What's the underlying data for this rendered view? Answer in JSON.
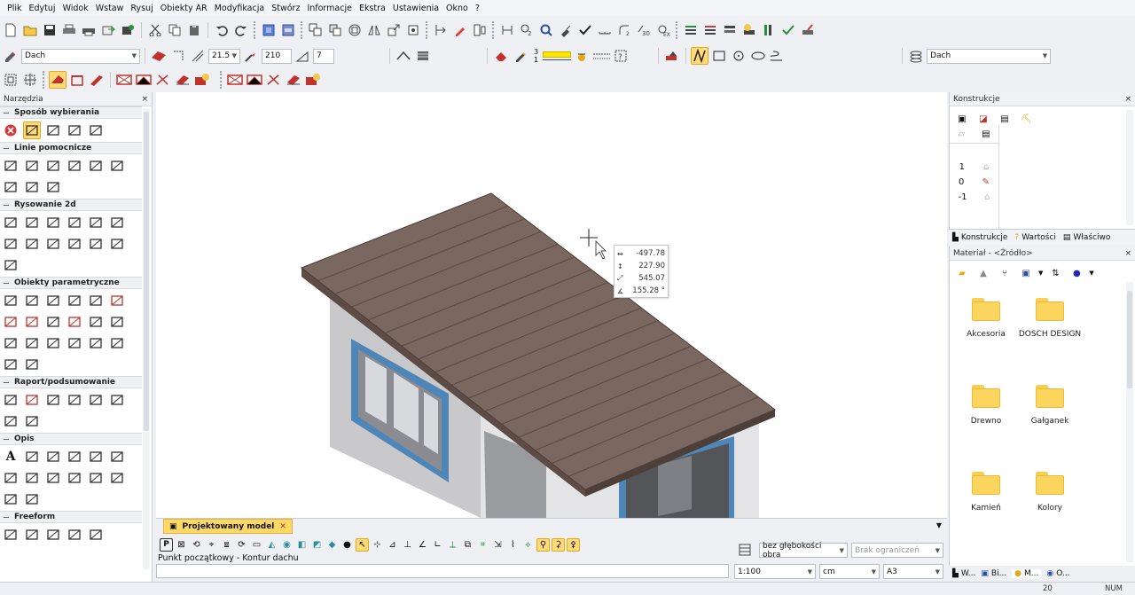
{
  "menu": [
    "Plik",
    "Edytuj",
    "Widok",
    "Wstaw",
    "Rysuj",
    "Obiekty AR",
    "Modyfikacja",
    "Stwórz",
    "Informacje",
    "Ekstra",
    "Ustawienia",
    "Okno",
    "?"
  ],
  "toolbar": {
    "layer_combo": "Dach",
    "thickness_combo": "21.5",
    "angle_value": "210",
    "count_value": "7",
    "pen_top": "3",
    "pen_bottom": "1",
    "layer_combo_right": "Dach",
    "accent_color": "#ffe600"
  },
  "left_panel": {
    "title": "Narzędzia",
    "sections": [
      {
        "title": "Sposób wybierania",
        "icons": [
          "delete-selection-icon",
          "select-arrow-icon",
          "layers-select-icon",
          "rectangle-select-icon",
          "polyline-select-icon"
        ]
      },
      {
        "title": "Linie pomocnicze",
        "icons": [
          "diagonal-line-icon",
          "angle-line-icon",
          "parallel-line-icon",
          "hatched-line-icon",
          "crosshair-icon",
          "dial-icon",
          "circle-point-icon",
          "half-circle-icon",
          "rotate-point-icon"
        ]
      },
      {
        "title": "Rysowanie 2d",
        "icons": [
          "line-icon",
          "polyline-icon",
          "rectangle-icon",
          "dotted-rectangle-icon",
          "spiral-icon",
          "ring-icon",
          "circle-dot-icon",
          "arc-segment-icon",
          "arc-rotate-icon",
          "arc-icon",
          "triangle-icon",
          "ellipse-icon",
          "spline-icon"
        ]
      },
      {
        "title": "Obiekty parametryczne",
        "icons": [
          "wall-icon",
          "slab-icon",
          "beam-icon",
          "column-icon",
          "stair-icon",
          "roof-icon",
          "window-icon",
          "door-icon",
          "opening-icon",
          "roof-red-icon",
          "pipe-icon",
          "panel-icon",
          "grid-icon",
          "frame-icon",
          "box-icon",
          "truss-icon",
          "area-icon",
          "label-m2-icon",
          "dimension-icon",
          "plan-icon"
        ]
      },
      {
        "title": "Raport/podsumowanie",
        "icons": [
          "report-icon",
          "report-red-icon",
          "book-icon",
          "building-plan-icon",
          "floor-plan-icon",
          "list-report-icon",
          "report-sum-icon",
          "report-export-icon"
        ]
      },
      {
        "title": "Opis",
        "icons": [
          "text-icon",
          "dimension-h-icon",
          "auto-label-icon",
          "nah-label-icon",
          "measure-icon",
          "arrow-curve-icon",
          "level-icon",
          "level-mark-icon",
          "circle-measure-icon",
          "angle-measure-icon",
          "angle-arc-icon",
          "triangle-measure-icon",
          "section-mark-icon",
          "arrow-left-icon"
        ]
      },
      {
        "title": "Freeform",
        "icons": [
          "ff-plane-icon",
          "ff-box-icon",
          "ff-cylinder-icon",
          "ff-torus-icon",
          "ff-extrude-icon"
        ]
      }
    ]
  },
  "viewport": {
    "tooltip": [
      "-497.78",
      "227.90",
      "545.07",
      "155.28 °"
    ]
  },
  "doc_tab": "Projektowany model",
  "prompt": "Punkt początkowy - Kontur dachu",
  "depth_combo": "bez głębokości obra",
  "limit_combo": "Brak ograniczeń",
  "scale_combo": "1:100",
  "unit_combo": "cm",
  "paper_combo": "A3",
  "right_panel": {
    "title": "Konstrukcje",
    "levels": [
      "1",
      "0",
      "-1"
    ],
    "tabs": [
      "Konstrukcje",
      "Wartości",
      "Właściwo"
    ],
    "material_title": "Materiał - <Źródło>",
    "folders": [
      "Akcesoria",
      "DOSCH DESIGN",
      "Drewno",
      "Gałganek",
      "Kamień",
      "Kolory"
    ],
    "bottom_tabs": [
      "W...",
      "Bi...",
      "M...",
      "O..."
    ]
  },
  "status": {
    "coord": "20",
    "mode": "NUM"
  },
  "roof": {
    "color": "#7a675f"
  }
}
